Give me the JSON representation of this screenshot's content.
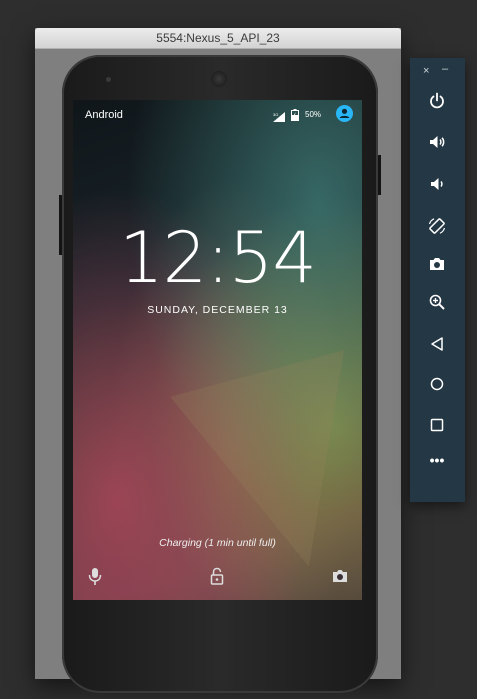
{
  "window": {
    "title": "5554:Nexus_5_API_23"
  },
  "status_bar": {
    "carrier": "Android",
    "battery_percent": "50%"
  },
  "lock_screen": {
    "time": "12:54",
    "date": "SUNDAY, DECEMBER 13",
    "charging": "Charging (1 min until full)"
  },
  "toolbar": {
    "close_label": "×",
    "minimize_label": "–",
    "more_label": "•••",
    "buttons": [
      {
        "name": "power",
        "icon": "power-icon"
      },
      {
        "name": "volume-up",
        "icon": "volume-up-icon"
      },
      {
        "name": "volume-down",
        "icon": "volume-down-icon"
      },
      {
        "name": "rotate",
        "icon": "rotate-icon"
      },
      {
        "name": "screenshot",
        "icon": "camera-icon"
      },
      {
        "name": "zoom",
        "icon": "zoom-icon"
      },
      {
        "name": "back",
        "icon": "back-icon"
      },
      {
        "name": "home",
        "icon": "home-icon"
      },
      {
        "name": "overview",
        "icon": "overview-icon"
      }
    ]
  },
  "colors": {
    "toolbar_bg": "#243744",
    "accent_user": "#29b6f6"
  }
}
